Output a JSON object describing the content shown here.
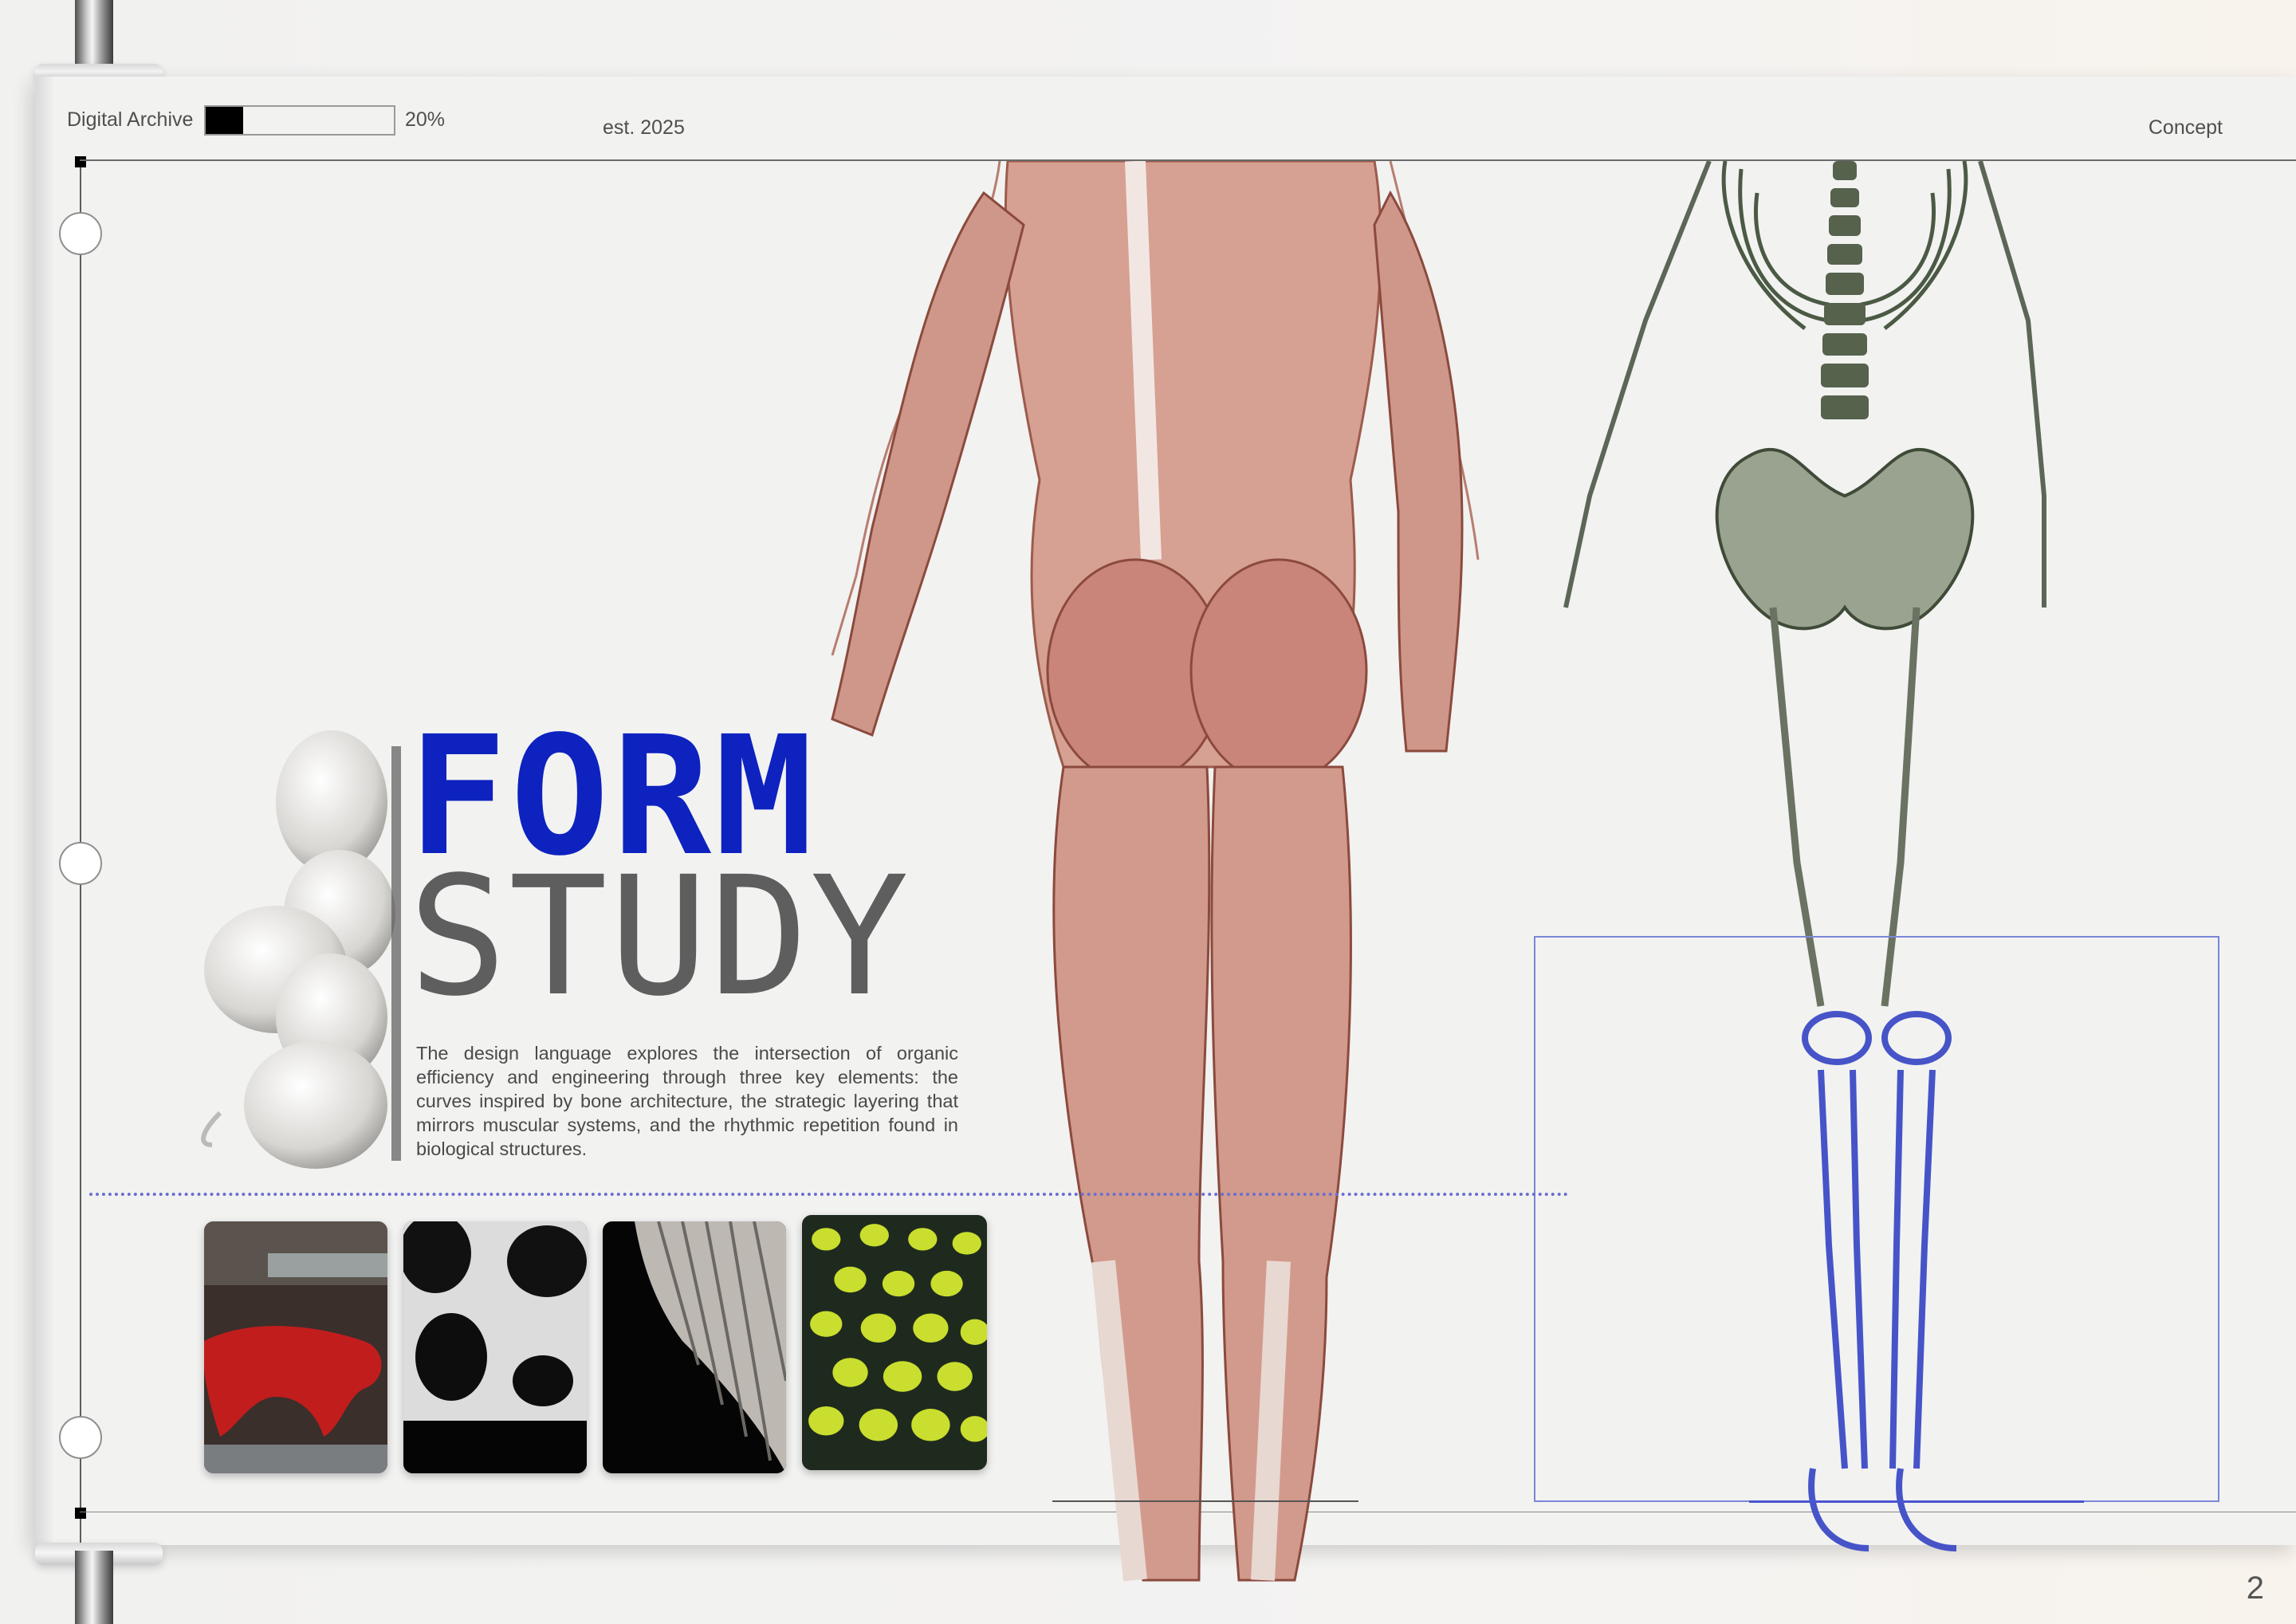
{
  "header": {
    "title": "Digital Archive",
    "progress_percent": 20,
    "progress_label": "20%",
    "established": "est. 2025",
    "section": "Concept"
  },
  "title": {
    "line1": "FORM",
    "line2": "STUDY"
  },
  "body": {
    "text": "The design language explores the intersection of organic efficiency and engineering through three key elements: the curves inspired by bone architecture, the strategic layering that mirrors muscular systems, and the rhythmic repetition found in biological structures."
  },
  "gallery": {
    "thumbnails": [
      {
        "subject": "red organic bench"
      },
      {
        "subject": "black and white voronoi form"
      },
      {
        "subject": "ribbed white relief"
      },
      {
        "subject": "green cellular lattice"
      }
    ]
  },
  "colors": {
    "accent_blue": "#0d22bf",
    "frame_blue": "#7c87d8",
    "title_gray": "#5e5e5e"
  },
  "page_number": "2"
}
